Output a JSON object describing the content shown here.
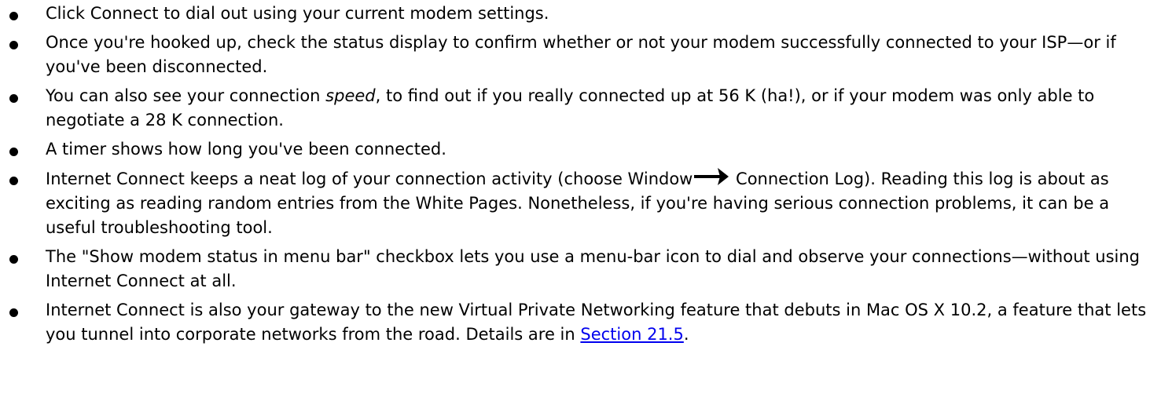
{
  "bullet_icon": "filled-circle",
  "link_color": "#0000ee",
  "items": [
    {
      "text": "Click Connect to dial out using your current modem settings."
    },
    {
      "text": "Once you're hooked up, check the status display to confirm whether or not your modem successfully connected to your ISP—or if you've been disconnected."
    },
    {
      "text_before": "You can also see your connection ",
      "emphasis": "speed",
      "text_after": ", to find out if you really connected up at 56 K (ha!), or if your modem was only able to negotiate a 28 K connection."
    },
    {
      "text": "A timer shows how long you've been connected."
    },
    {
      "text_before": "Internet Connect keeps a neat log of your connection activity (choose Window",
      "arrow_icon": "right-arrow-icon",
      "text_after": " Connection Log). Reading this log is about as exciting as reading random entries from the White Pages. Nonetheless, if you're having serious connection problems, it can be a useful troubleshooting tool."
    },
    {
      "text": "The \"Show modem status in menu bar\" checkbox lets you use a menu-bar icon to dial and observe your connections—without using Internet Connect at all."
    },
    {
      "text_before": "Internet Connect is also your gateway to the new Virtual Private Networking feature that debuts in Mac OS X 10.2, a feature that lets you tunnel into corporate networks from the road. Details are in ",
      "link_text": "Section 21.5",
      "text_after": "."
    }
  ]
}
